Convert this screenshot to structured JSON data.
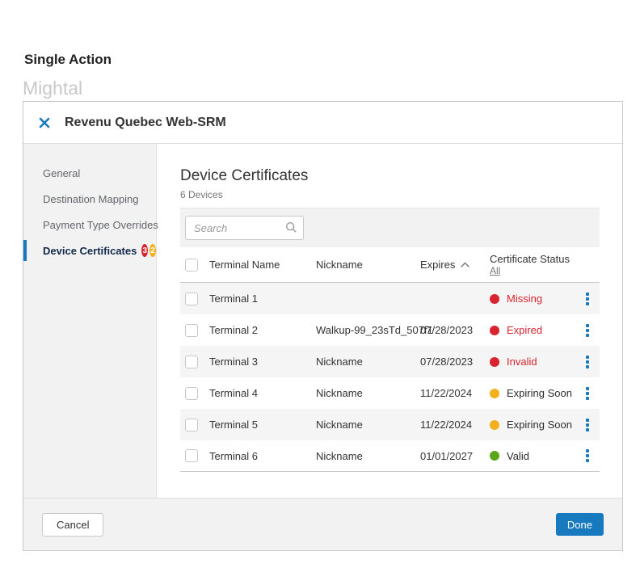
{
  "page": {
    "heading": "Single Action",
    "watermark": "Mightal"
  },
  "colors": {
    "accent_blue": "#1779be",
    "status_red": "#d9232e",
    "status_yellow": "#f2b01e",
    "status_green": "#5ba616",
    "dark_text": "#2d2d2d"
  },
  "modal": {
    "title": "Revenu Quebec Web-SRM",
    "sidebar": {
      "items": {
        "0": {
          "label": "General"
        },
        "1": {
          "label": "Destination Mapping"
        },
        "2": {
          "label": "Payment Type Overrides"
        },
        "3": {
          "label": "Device Certificates",
          "badge_red_count": "3",
          "badge_yellow_count": "2"
        }
      }
    },
    "content": {
      "title": "Device Certificates",
      "subtitle": "6 Devices",
      "search": {
        "placeholder": "Search"
      },
      "table": {
        "columns": {
          "terminal": "Terminal Name",
          "nickname": "Nickname",
          "expires": "Expires",
          "status": "Certificate Status"
        },
        "expires_sort": "asc",
        "status_filter_link": "All",
        "rows": {
          "0": {
            "terminal": "Terminal 1",
            "nickname": "",
            "expires": "",
            "status": "Missing",
            "dot_color": "#d9232e",
            "text_color": "#d9232e"
          },
          "1": {
            "terminal": "Terminal 2",
            "nickname": "Walkup-99_23sTd_507f1",
            "expires": "07/28/2023",
            "status": "Expired",
            "dot_color": "#d9232e",
            "text_color": "#d9232e"
          },
          "2": {
            "terminal": "Terminal 3",
            "nickname": "Nickname",
            "expires": "07/28/2023",
            "status": "Invalid",
            "dot_color": "#d9232e",
            "text_color": "#d9232e"
          },
          "3": {
            "terminal": "Terminal 4",
            "nickname": "Nickname",
            "expires": "11/22/2024",
            "status": "Expiring Soon",
            "dot_color": "#f2b01e",
            "text_color": "#2d2d2d"
          },
          "4": {
            "terminal": "Terminal 5",
            "nickname": "Nickname",
            "expires": "11/22/2024",
            "status": "Expiring Soon",
            "dot_color": "#f2b01e",
            "text_color": "#2d2d2d"
          },
          "5": {
            "terminal": "Terminal 6",
            "nickname": "Nickname",
            "expires": "01/01/2027",
            "status": "Valid",
            "dot_color": "#5ba616",
            "text_color": "#2d2d2d"
          }
        }
      }
    },
    "footer": {
      "cancel_label": "Cancel",
      "done_label": "Done"
    }
  }
}
